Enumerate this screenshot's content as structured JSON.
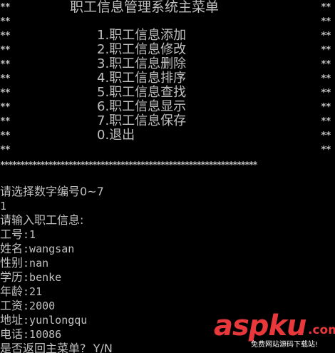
{
  "menu": {
    "title": "职工信息管理系统主菜单",
    "items": [
      "1.职工信息添加",
      "2.职工信息修改",
      "3.职工信息删除",
      "4.职工信息排序",
      "5.职工信息查找",
      "6.职工信息显示",
      "7.职工信息保存",
      "0.退出"
    ],
    "side_border": "**",
    "bottom_border": "****************************************************************"
  },
  "output": {
    "prompt_select": "请选择数字编号0~7",
    "input_choice": "1",
    "prompt_info": "请输入职工信息:",
    "fields": [
      {
        "label": "工号",
        "value": "1"
      },
      {
        "label": "姓名",
        "value": "wangsan"
      },
      {
        "label": "性别",
        "value": "nan"
      },
      {
        "label": "学历",
        "value": "benke"
      },
      {
        "label": "年龄",
        "value": "21"
      },
      {
        "label": "工资",
        "value": "2000"
      },
      {
        "label": "地址",
        "value": "yunlongqu"
      },
      {
        "label": "电话",
        "value": "10086"
      }
    ],
    "separator": ":",
    "prompt_return": "是否返回主菜单?  Y/N"
  },
  "watermark": {
    "logo": "aspku",
    "tld": ".com",
    "subtitle": "免费网站源码下载站!",
    "color": "#e8383c"
  },
  "colors": {
    "background": "#000000",
    "text": "#c0c0c0"
  }
}
